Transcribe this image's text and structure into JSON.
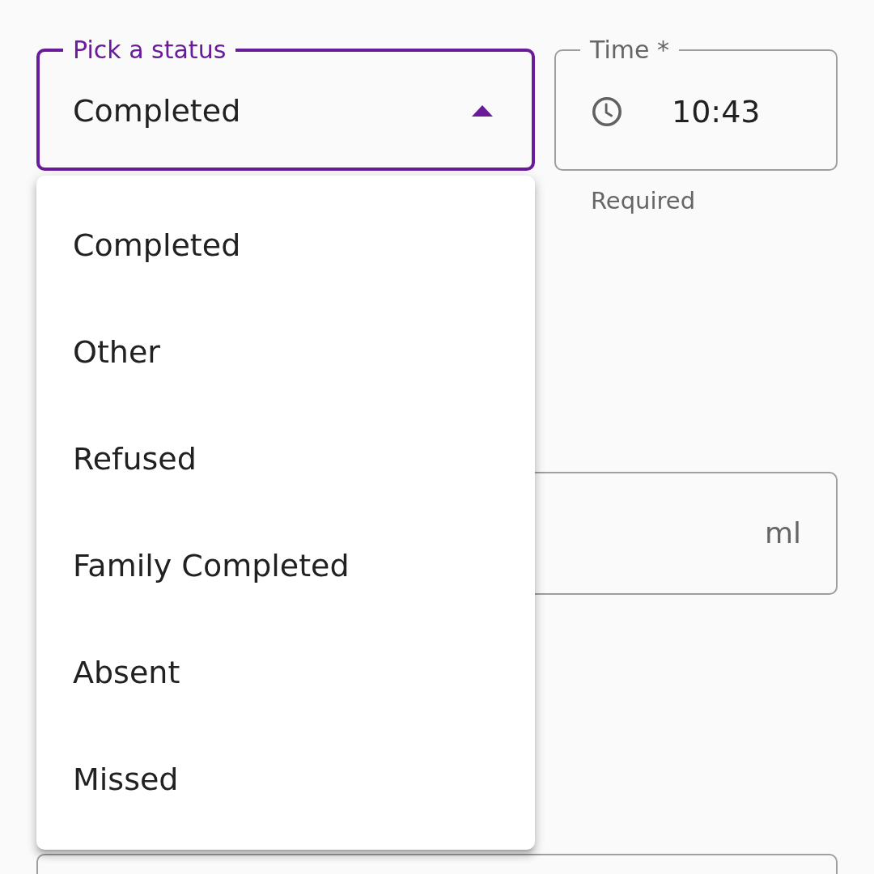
{
  "status_select": {
    "label": "Pick a status",
    "value": "Completed",
    "focused": true,
    "expanded": true,
    "options": [
      "Completed",
      "Other",
      "Refused",
      "Family Completed",
      "Absent",
      "Missed"
    ]
  },
  "time_field": {
    "label": "Time *",
    "value": "10:43",
    "helper": "Required"
  },
  "volume_field": {
    "unit": "ml"
  }
}
